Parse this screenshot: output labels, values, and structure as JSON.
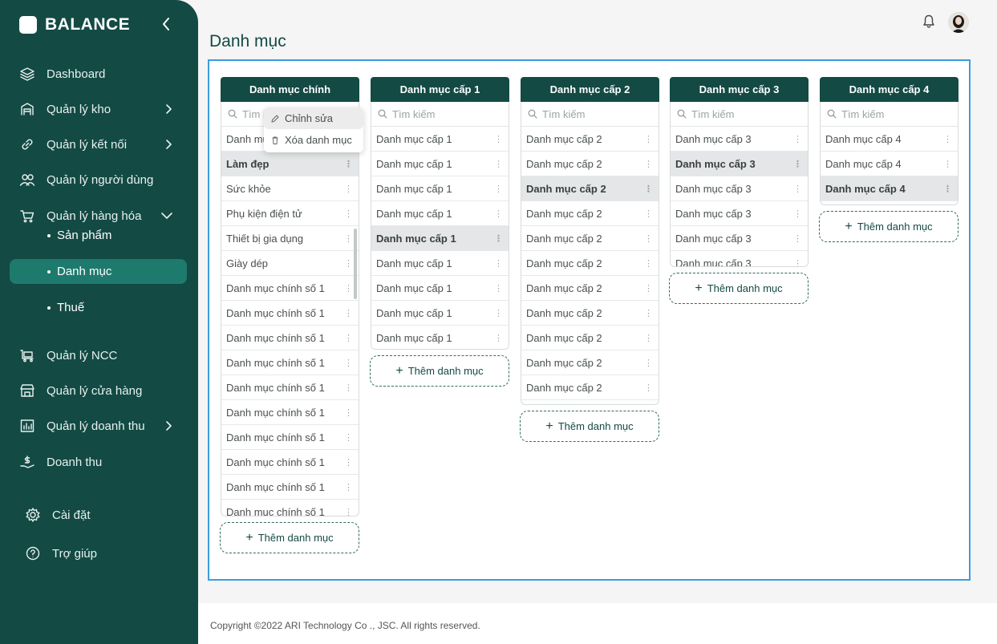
{
  "brand": {
    "name": "BALANCE"
  },
  "sidebar": {
    "items": [
      {
        "label": "Dashboard",
        "icon": "layers-icon",
        "chevron": ""
      },
      {
        "label": "Quản lý kho",
        "icon": "warehouse-icon",
        "chevron": "right"
      },
      {
        "label": "Quản lý kết nối",
        "icon": "link-icon",
        "chevron": "right"
      },
      {
        "label": "Quản lý người dùng",
        "icon": "users-icon",
        "chevron": ""
      },
      {
        "label": "Quản lý hàng hóa",
        "icon": "cart-icon",
        "chevron": "down"
      }
    ],
    "sub_items": [
      {
        "label": "Sản phẩm",
        "active": false
      },
      {
        "label": "Danh mục",
        "active": true
      },
      {
        "label": "Thuế",
        "active": false
      }
    ],
    "items_after": [
      {
        "label": "Quản lý NCC",
        "icon": "supplier-cart-icon",
        "chevron": ""
      },
      {
        "label": "Quản lý cửa hàng",
        "icon": "store-icon",
        "chevron": ""
      },
      {
        "label": "Quản lý doanh thu",
        "icon": "bar-chart-icon",
        "chevron": "right"
      },
      {
        "label": "Doanh thu",
        "icon": "money-hand-icon",
        "chevron": ""
      }
    ],
    "bottom_items": [
      {
        "label": "Cài đặt",
        "icon": "gear-icon"
      },
      {
        "label": "Trợ giúp",
        "icon": "help-icon"
      }
    ]
  },
  "page": {
    "title": "Danh mục"
  },
  "columns": [
    {
      "header": "Danh mục chính",
      "search_placeholder": "Tìm kiếm",
      "rows": [
        {
          "label": "Danh mục",
          "selected": false
        },
        {
          "label": "Làm đẹp",
          "selected": true
        },
        {
          "label": "Sức khỏe",
          "selected": false
        },
        {
          "label": "Phụ kiện điện tử",
          "selected": false
        },
        {
          "label": "Thiết bị gia dụng",
          "selected": false
        },
        {
          "label": "Giày dép",
          "selected": false
        },
        {
          "label": "Danh mục chính số 1",
          "selected": false
        },
        {
          "label": "Danh mục chính số 1",
          "selected": false
        },
        {
          "label": "Danh mục chính số 1",
          "selected": false
        },
        {
          "label": "Danh mục chính số 1",
          "selected": false
        },
        {
          "label": "Danh mục chính số 1",
          "selected": false
        },
        {
          "label": "Danh mục chính số 1",
          "selected": false
        },
        {
          "label": "Danh mục chính số 1",
          "selected": false
        },
        {
          "label": "Danh mục chính số 1",
          "selected": false
        },
        {
          "label": "Danh mục chính số 1",
          "selected": false
        },
        {
          "label": "Danh mục chính số 1",
          "selected": false
        }
      ],
      "add_label": "Thêm danh mục"
    },
    {
      "header": "Danh mục cấp 1",
      "search_placeholder": "Tìm kiếm",
      "rows": [
        {
          "label": "Danh mục cấp 1",
          "selected": false
        },
        {
          "label": "Danh mục cấp 1",
          "selected": false
        },
        {
          "label": "Danh mục cấp 1",
          "selected": false
        },
        {
          "label": "Danh mục cấp 1",
          "selected": false
        },
        {
          "label": "Danh mục cấp 1",
          "selected": true
        },
        {
          "label": "Danh mục cấp 1",
          "selected": false
        },
        {
          "label": "Danh mục cấp 1",
          "selected": false
        },
        {
          "label": "Danh mục cấp 1",
          "selected": false
        },
        {
          "label": "Danh mục cấp 1",
          "selected": false
        }
      ],
      "add_label": "Thêm danh mục"
    },
    {
      "header": "Danh mục cấp 2",
      "search_placeholder": "Tìm kiếm",
      "rows": [
        {
          "label": "Danh mục cấp 2",
          "selected": false
        },
        {
          "label": "Danh mục cấp 2",
          "selected": false
        },
        {
          "label": "Danh mục cấp 2",
          "selected": true
        },
        {
          "label": "Danh mục cấp 2",
          "selected": false
        },
        {
          "label": "Danh mục cấp 2",
          "selected": false
        },
        {
          "label": "Danh mục cấp 2",
          "selected": false
        },
        {
          "label": "Danh mục cấp 2",
          "selected": false
        },
        {
          "label": "Danh mục cấp 2",
          "selected": false
        },
        {
          "label": "Danh mục cấp 2",
          "selected": false
        },
        {
          "label": "Danh mục cấp 2",
          "selected": false
        },
        {
          "label": "Danh mục cấp 2",
          "selected": false
        }
      ],
      "add_label": "Thêm danh mục"
    },
    {
      "header": "Danh mục cấp 3",
      "search_placeholder": "Tìm kiếm",
      "rows": [
        {
          "label": "Danh mục cấp 3",
          "selected": false
        },
        {
          "label": "Danh mục cấp 3",
          "selected": true
        },
        {
          "label": "Danh mục cấp 3",
          "selected": false
        },
        {
          "label": "Danh mục cấp 3",
          "selected": false
        },
        {
          "label": "Danh mục cấp 3",
          "selected": false
        },
        {
          "label": "Danh mục cấp 3",
          "selected": false
        }
      ],
      "add_label": "Thêm danh mục"
    },
    {
      "header": "Danh mục cấp 4",
      "search_placeholder": "Tìm kiếm",
      "rows": [
        {
          "label": "Danh mục cấp 4",
          "selected": false
        },
        {
          "label": "Danh mục cấp 4",
          "selected": false
        },
        {
          "label": "Danh mục cấp 4",
          "selected": true
        }
      ],
      "add_label": "Thêm danh mục"
    }
  ],
  "context_menu": {
    "edit_label": "Chỉnh sửa",
    "delete_label": "Xóa danh mục"
  },
  "footer": {
    "copyright": "Copyright ©2022 ARI Technology Co ., JSC. All rights reserved."
  },
  "colors": {
    "primary": "#134a44",
    "active": "#1e7a6d",
    "board_border": "#3a9de0"
  }
}
